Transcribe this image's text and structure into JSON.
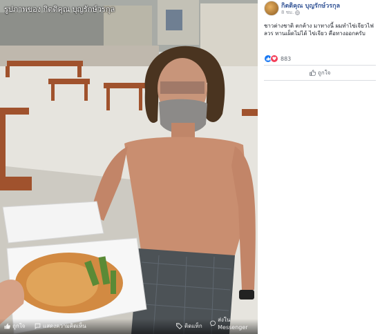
{
  "viewer": {
    "title": "รูปภาพของ กิตติคุณ บุญรักษ์วรกุล",
    "actions": {
      "like": "ถูกใจ",
      "comment": "แสดงความคิดเห็น",
      "tag": "ติดแท็ก",
      "share": "ส่งใน Messenger"
    }
  },
  "post": {
    "author": "กิตติคุณ บุญรักษ์วรกุล",
    "time": "8 ชม.",
    "caption": "ชาวต่างชาติ ตกค้าง มาทางนี้ ผมทำไข่เจียวไฟลวร ทานเผ็ดไม่ได้ ไข่เจียว คือทางออกครับ",
    "reaction_count": "883",
    "like_label": "ถูกใจ"
  },
  "icons": {
    "like": "thumbs-up-icon",
    "comment": "comment-icon",
    "tag": "tag-icon",
    "share": "messenger-icon",
    "globe": "globe-icon",
    "love": "heart-icon"
  },
  "colors": {
    "link": "#385898",
    "like_blue": "#1877f2",
    "love_red": "#f33e58",
    "meta_grey": "#90949c"
  }
}
